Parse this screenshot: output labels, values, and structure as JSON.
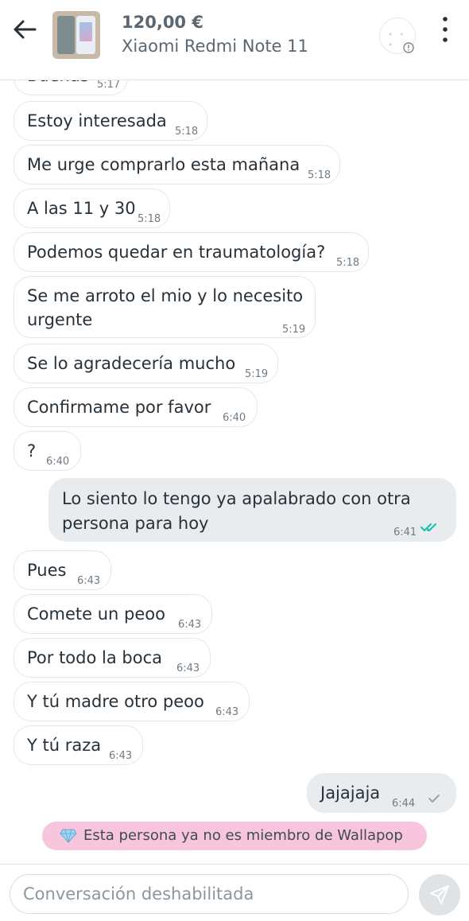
{
  "header": {
    "price": "120,00 €",
    "product": "Xiaomi Redmi Note 11"
  },
  "messages": [
    {
      "text": "Buenas",
      "time": "5:17",
      "dir": "in"
    },
    {
      "text": "Estoy interesada",
      "time": "5:18",
      "dir": "in"
    },
    {
      "text": "Me urge comprarlo esta mañana",
      "time": "5:18",
      "dir": "in"
    },
    {
      "text": "A las 11 y 30",
      "time": "5:18",
      "dir": "in"
    },
    {
      "text": "Podemos quedar en traumatología?",
      "time": "5:18",
      "dir": "in"
    },
    {
      "line1": "Se me arroto el mio y lo necesito",
      "line2": "urgente",
      "time": "5:19",
      "dir": "in"
    },
    {
      "text": "Se lo agradecería mucho",
      "time": "5:19",
      "dir": "in"
    },
    {
      "text": "Confirmame por favor",
      "time": "6:40",
      "dir": "in"
    },
    {
      "text": "?",
      "time": "6:40",
      "dir": "in"
    },
    {
      "line1": "Lo siento lo tengo ya apalabrado con otra",
      "line2": "persona para hoy",
      "time": "6:41",
      "dir": "out",
      "status": "read"
    },
    {
      "text": "Pues",
      "time": "6:43",
      "dir": "in"
    },
    {
      "text": "Comete un peoo",
      "time": "6:43",
      "dir": "in"
    },
    {
      "text": "Por todo la boca",
      "time": "6:43",
      "dir": "in"
    },
    {
      "text": "Y tú madre otro peoo",
      "time": "6:43",
      "dir": "in"
    },
    {
      "text": "Y tú raza",
      "time": "6:43",
      "dir": "in"
    },
    {
      "text": "Jajajaja",
      "time": "6:44",
      "dir": "out",
      "status": "delivered"
    }
  ],
  "banner": {
    "text": "Esta persona ya no es miembro de Wallapop"
  },
  "composer": {
    "placeholder": "Conversación deshabilitada"
  },
  "colors": {
    "incoming_bubble": "#ffffff",
    "outgoing_bubble": "#e9ecef",
    "banner_bg": "#f7c6dd",
    "read_ticks": "#13c1ac"
  },
  "icons": [
    "back-arrow-icon",
    "more-vertical-icon",
    "info-icon",
    "read-check-icon",
    "delivered-check-icon",
    "diamond-icon",
    "send-icon"
  ]
}
